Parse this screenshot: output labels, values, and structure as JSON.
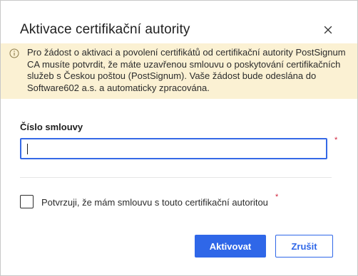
{
  "dialog": {
    "title": "Aktivace certifikační autority",
    "close_icon": "close-icon"
  },
  "info_banner": {
    "icon": "info-icon",
    "text": "Pro žádost o aktivaci a povolení certifikátů od certifikační autority PostSignum CA musíte potvrdit, že máte uzavřenou smlouvu o poskytování certifikačních služeb s Českou poštou (PostSignum). Vaše žádost bude odeslána do Software602 a.s. a automaticky zpracována."
  },
  "contract_field": {
    "label": "Číslo smlouvy",
    "value": "",
    "required_mark": "*"
  },
  "confirm_checkbox": {
    "label": "Potvrzuji, že mám smlouvu s touto certifikační autoritou",
    "checked": false,
    "required_mark": "*"
  },
  "buttons": {
    "activate_label": "Aktivovat",
    "cancel_label": "Zrušit"
  },
  "colors": {
    "accent": "#2f67e8",
    "banner_bg": "#fbf1d3",
    "required": "#d0223a"
  }
}
